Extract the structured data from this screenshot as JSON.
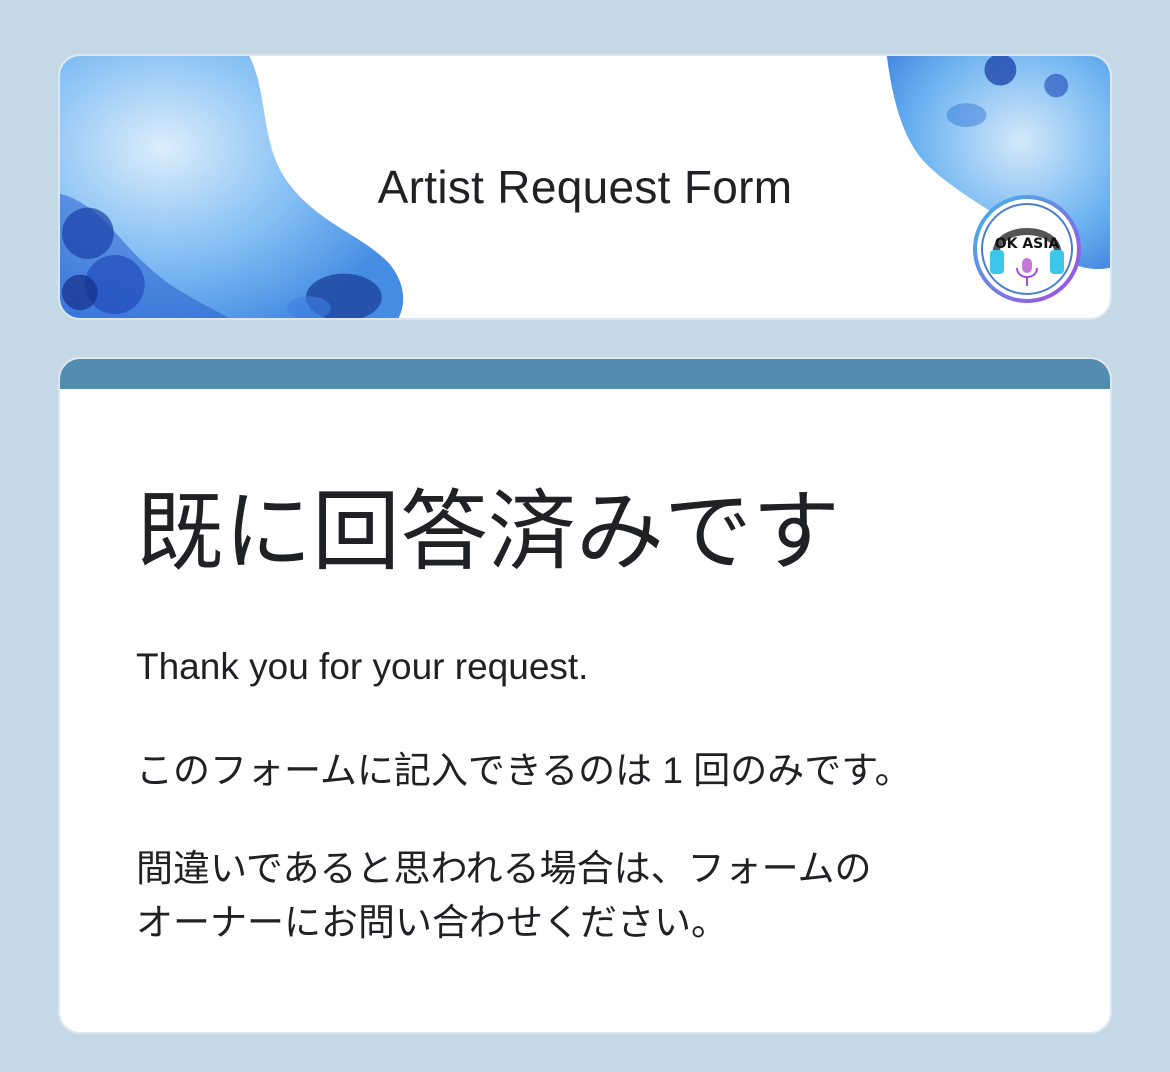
{
  "header": {
    "title": "Artist Request Form",
    "logo_text": "OK ASIA"
  },
  "confirmation": {
    "heading": "既に回答済みです",
    "thank_you": "Thank you for your request.",
    "limit_notice": "このフォームに記入できるのは 1 回のみです。",
    "contact_line1": "間違いであると思われる場合は、フォームの",
    "contact_line2": "オーナーにお問い合わせください。"
  },
  "colors": {
    "page_background": "#c5d8e6",
    "accent": "#528db0",
    "banner_blue": "#4a9ef0",
    "banner_dark": "#1a3fa8",
    "text": "#202124"
  },
  "icons": [
    "watercolor-banner",
    "headphones-icon",
    "microphone-icon"
  ]
}
